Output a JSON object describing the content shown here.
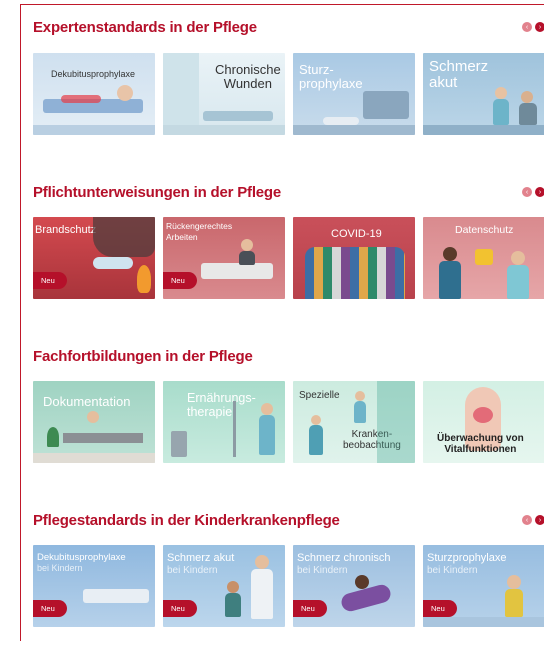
{
  "sections": [
    {
      "title": "Expertenstandards in der Pflege",
      "cards": [
        {
          "title": "Dekubitusprophylaxe",
          "sub": "",
          "badge": ""
        },
        {
          "title": "Chronische\nWunden",
          "sub": "",
          "badge": ""
        },
        {
          "title": "Sturz-\nprophylaxe",
          "sub": "",
          "badge": ""
        },
        {
          "title": "Schmerz\nakut",
          "sub": "",
          "badge": ""
        }
      ]
    },
    {
      "title": "Pflichtunterweisungen in der Pflege",
      "cards": [
        {
          "title": "Brandschutz",
          "sub": "",
          "badge": "Neu"
        },
        {
          "title": "Rückengerechtes\nArbeiten",
          "sub": "",
          "badge": "Neu"
        },
        {
          "title": "COVID-19",
          "sub": "",
          "badge": ""
        },
        {
          "title": "Datenschutz",
          "sub": "",
          "badge": ""
        }
      ]
    },
    {
      "title": "Fachfortbildungen in der Pflege",
      "cards": [
        {
          "title": "Dokumentation",
          "sub": "",
          "badge": ""
        },
        {
          "title": "Ernährungs-\ntherapie",
          "sub": "",
          "badge": ""
        },
        {
          "title": "Spezielle",
          "sub": "Kranken-\nbeobachtung",
          "badge": ""
        },
        {
          "title": "Überwachung von\nVitalfunktionen",
          "sub": "",
          "badge": ""
        }
      ]
    },
    {
      "title": "Pflegestandards in der Kinderkrankenpflege",
      "cards": [
        {
          "title": "Dekubitusprophylaxe",
          "sub": "bei Kindern",
          "badge": "Neu"
        },
        {
          "title": "Schmerz akut",
          "sub": "bei Kindern",
          "badge": "Neu"
        },
        {
          "title": "Schmerz chronisch",
          "sub": "bei Kindern",
          "badge": "Neu"
        },
        {
          "title": "Sturzprophylaxe",
          "sub": "bei Kindern",
          "badge": "Neu"
        }
      ]
    }
  ],
  "icons": {
    "prev": "chevron-left-icon",
    "next": "chevron-right-icon"
  },
  "colors": {
    "brand": "#b5102a",
    "arrow_prev": "#e2828d"
  }
}
